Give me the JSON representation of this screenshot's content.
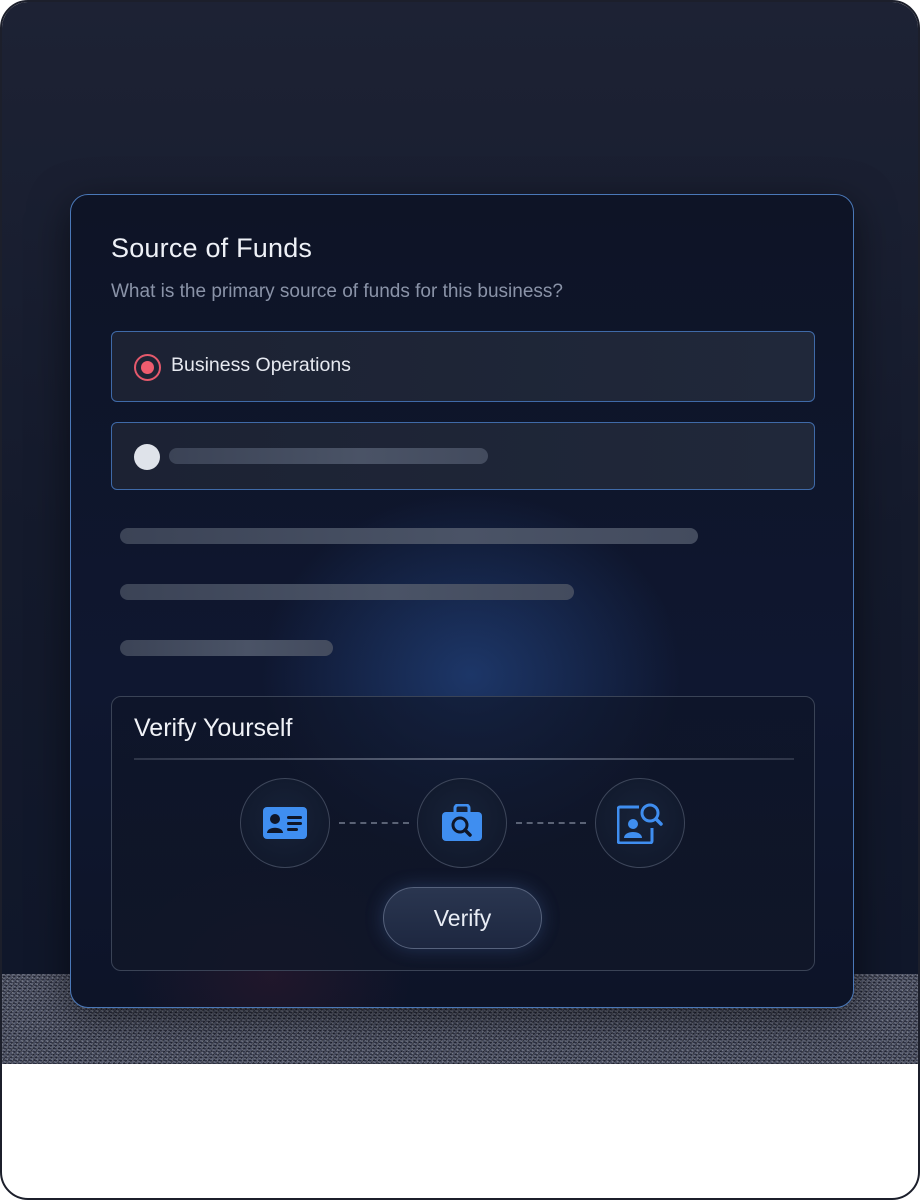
{
  "card": {
    "title": "Source of Funds",
    "subtitle": "What is the primary source of funds for this business?",
    "options": [
      {
        "label": "Business Operations",
        "selected": true
      },
      {
        "label": "",
        "selected": false
      }
    ]
  },
  "verify": {
    "title": "Verify Yourself",
    "steps": [
      {
        "icon": "id-card-icon"
      },
      {
        "icon": "briefcase-search-icon"
      },
      {
        "icon": "profile-search-icon"
      }
    ],
    "button_label": "Verify"
  },
  "colors": {
    "accent_blue": "#3f8ef0",
    "radio_selected": "#ef5c6e",
    "card_border": "#4a78b8"
  }
}
